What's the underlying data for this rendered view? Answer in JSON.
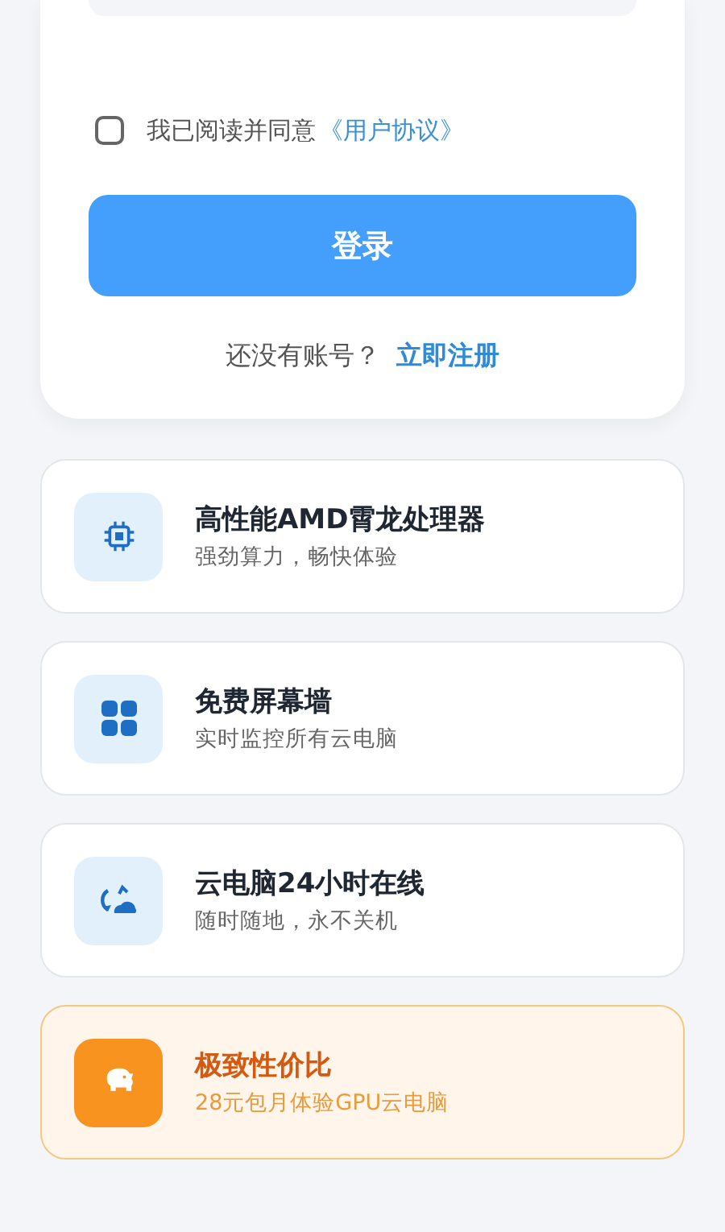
{
  "login_card": {
    "agreement": {
      "checked": false,
      "text": "我已阅读并同意",
      "link": "《用户协议》"
    },
    "login_button": "登录",
    "register_prompt": "还没有账号？",
    "register_link": "立即注册"
  },
  "features": [
    {
      "kind": "normal",
      "title": "高性能AMD霄龙处理器",
      "subtitle": "强劲算力，畅快体验"
    },
    {
      "kind": "normal",
      "title": "免费屏幕墙",
      "subtitle": "实时监控所有云电脑"
    },
    {
      "kind": "normal",
      "title": "云电脑24小时在线",
      "subtitle": "随时随地，永不关机"
    },
    {
      "kind": "highlight",
      "title": "极致性价比",
      "subtitle": "28元包月体验GPU云电脑"
    }
  ]
}
